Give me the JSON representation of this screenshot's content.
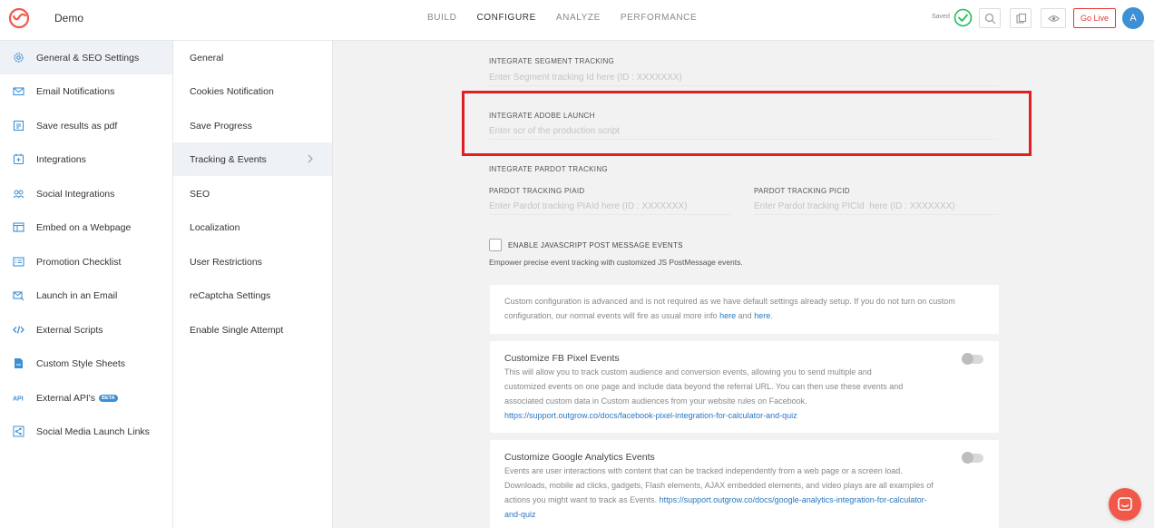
{
  "header": {
    "app_name": "Demo",
    "nav": [
      "BUILD",
      "CONFIGURE",
      "ANALYZE",
      "PERFORMANCE"
    ],
    "active_nav": "CONFIGURE",
    "saved_label": "Saved",
    "go_live_label": "Go Live",
    "avatar_initial": "A"
  },
  "sidebar": {
    "items": [
      {
        "label": "General & SEO Settings",
        "icon": "gear-icon"
      },
      {
        "label": "Email Notifications",
        "icon": "mail-icon"
      },
      {
        "label": "Save results as pdf",
        "icon": "pdf-icon"
      },
      {
        "label": "Integrations",
        "icon": "integrations-icon"
      },
      {
        "label": "Social Integrations",
        "icon": "social-icon"
      },
      {
        "label": "Embed on a Webpage",
        "icon": "embed-icon"
      },
      {
        "label": "Promotion Checklist",
        "icon": "checklist-icon"
      },
      {
        "label": "Launch in an Email",
        "icon": "launch-email-icon"
      },
      {
        "label": "External Scripts",
        "icon": "code-icon"
      },
      {
        "label": "Custom Style Sheets",
        "icon": "css-file-icon"
      },
      {
        "label": "External API's",
        "icon": "api-icon",
        "badge": "BETA"
      },
      {
        "label": "Social Media Launch Links",
        "icon": "share-icon"
      }
    ]
  },
  "submenu": {
    "items": [
      "General",
      "Cookies Notification",
      "Save Progress",
      "Tracking & Events",
      "SEO",
      "Localization",
      "User Restrictions",
      "reCaptcha Settings",
      "Enable Single Attempt"
    ],
    "active": "Tracking & Events"
  },
  "main": {
    "segment_label": "INTEGRATE SEGMENT TRACKING",
    "segment_placeholder": "Enter Segment tracking Id here (ID : XXXXXXX)",
    "adobe_label": "INTEGRATE ADOBE LAUNCH",
    "adobe_placeholder": "Enter scr of the production script",
    "pardot_label": "INTEGRATE PARDOT TRACKING",
    "piaid_label": "PARDOT TRACKING PIAID",
    "piaid_placeholder": "Enter Pardot tracking PIAId here (ID : XXXXXXX)",
    "picid_label": "PARDOT TRACKING PICID",
    "picid_placeholder": "Enter Pardot tracking PICId  here (ID : XXXXXXX)",
    "js_events_label": "ENABLE JAVASCRIPT POST MESSAGE EVENTS",
    "js_events_desc": "Empower precise event tracking with customized JS PostMessage events.",
    "custom_config": {
      "text": "Custom configuration is advanced and is not required as we have default settings already setup. If you do not turn on custom configuration, our normal events will fire as usual more info",
      "link1": "here",
      "and": "and",
      "link2": "here",
      "end": "."
    },
    "fb_card": {
      "title": "Customize FB Pixel Events",
      "text": "This will allow you to track custom audience and conversion events, allowing you to send multiple and customized events on one page and include data beyond the referral URL. You can then use these events and associated custom data in Custom audiences from your website rules on Facebook.",
      "link": "https://support.outgrow.co/docs/facebook-pixel-integration-for-calculator-and-quiz"
    },
    "ga_card": {
      "title": "Customize Google Analytics Events",
      "text": "Events are user interactions with content that can be tracked independently from a web page or a screen load. Downloads, mobile ad clicks, gadgets, Flash elements, AJAX embedded elements, and video plays are all examples of actions you might want to track as Events.",
      "link": "https://support.outgrow.co/docs/google-analytics-integration-for-calculator-and-quiz"
    }
  },
  "colors": {
    "accent": "#3d8fd6",
    "danger": "#e53935",
    "success": "#1fbf5a",
    "highlight": "#e02020"
  }
}
